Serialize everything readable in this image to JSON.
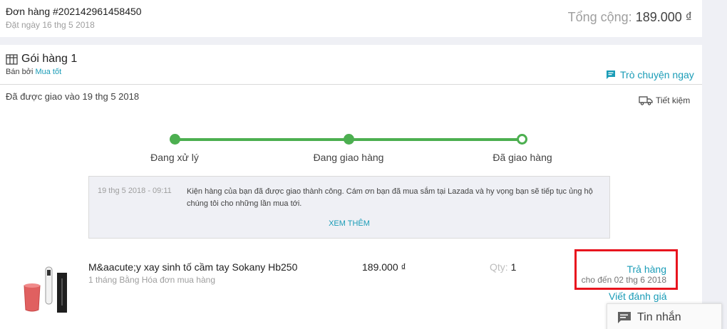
{
  "order": {
    "id": "Đơn hàng #202142961458450",
    "date": "Đặt ngày 16 thg 5 2018",
    "total_label": "Tổng cộng:",
    "total_amount": "189.000 ₫"
  },
  "package": {
    "title": "Gói hàng 1",
    "seller_prefix": "Bán bởi",
    "seller_name": "Mua tốt",
    "chat_label": "Trò chuyện ngay",
    "delivered_text": "Đã được giao vào 19 thg 5 2018",
    "shipping_method": "Tiết kiệm",
    "steps": [
      "Đang xử lý",
      "Đang giao hàng",
      "Đã giao hàng"
    ],
    "event": {
      "time": "19 thg 5 2018 - 09:11",
      "message": "Kiện hàng của bạn đã được giao thành công. Cám ơn bạn đã mua sắm tại Lazada và hy vọng bạn sẽ tiếp tục ủng hộ chúng tôi cho những lần mua tới.",
      "see_more": "XEM THÊM"
    }
  },
  "item": {
    "name": "M&aacute;y xay sinh tố cầm tay Sokany Hb250",
    "subtitle": "1 tháng Bằng Hóa đơn mua hàng",
    "price": "189.000 ₫",
    "qty_label": "Qty:",
    "qty_value": "1",
    "return_label": "Trả hàng",
    "return_until": "cho đến 02 thg 6 2018",
    "review_label": "Viết đánh giá"
  },
  "messages_widget": {
    "label": "Tin nhắn"
  },
  "colors": {
    "accent": "#1a9cb7",
    "progress": "#4caf50",
    "highlight": "#e8141e"
  }
}
